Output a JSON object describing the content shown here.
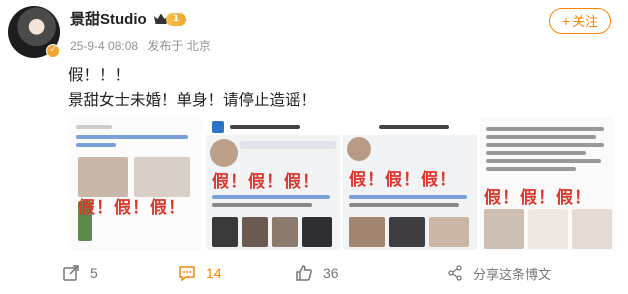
{
  "author": {
    "name": "景甜Studio",
    "level": "1"
  },
  "meta": {
    "timestamp": "25-9-4 08:08",
    "location": "发布于 北京"
  },
  "follow_label": "关注",
  "post": {
    "line1": "假！！！",
    "line2": "景甜女士未婚！单身！请停止造谣！"
  },
  "images": [
    {
      "stamp": "假！假！假！"
    },
    {
      "stamp": "假！假！假！"
    },
    {
      "stamp": "假！假！假！"
    },
    {
      "stamp": "假！假！假！"
    }
  ],
  "actions": {
    "repost_count": "5",
    "comment_count": "14",
    "like_count": "36",
    "share_label": "分享这条博文"
  },
  "colors": {
    "accent": "#ff8200",
    "stamp_red": "#e0352b",
    "muted": "#939393"
  }
}
